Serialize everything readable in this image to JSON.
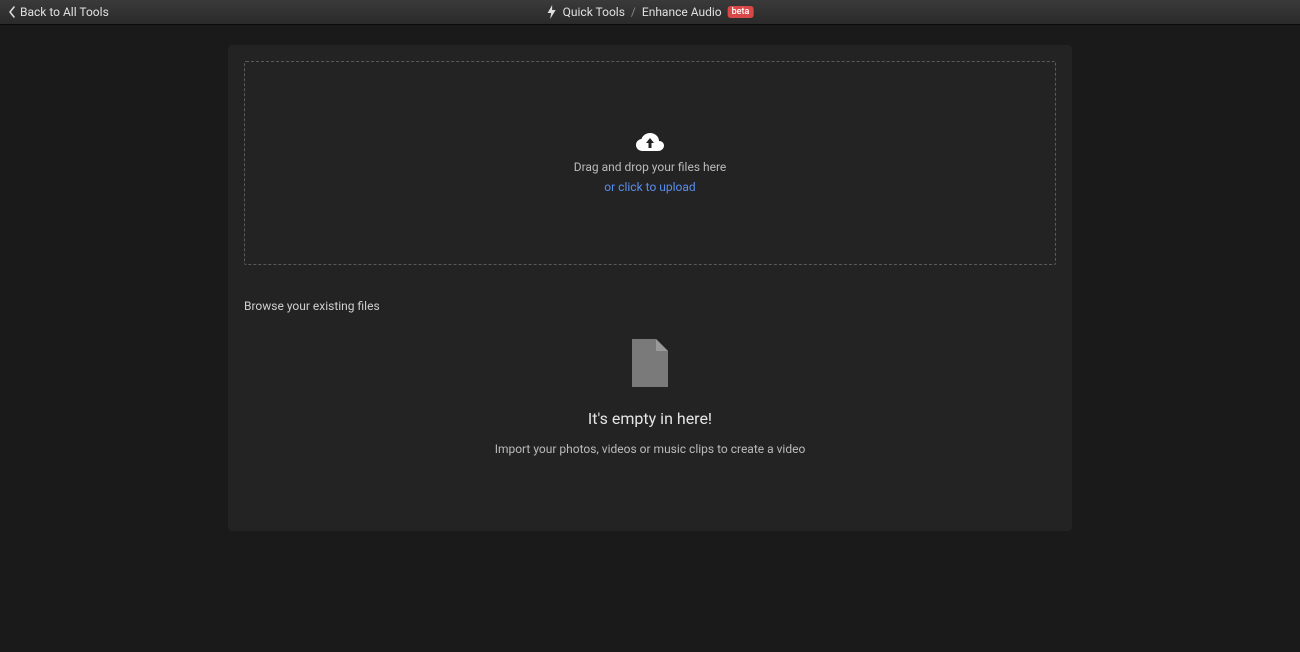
{
  "header": {
    "back_label": "Back to All Tools",
    "breadcrumb_root": "Quick Tools",
    "breadcrumb_current": "Enhance Audio",
    "beta_label": "beta"
  },
  "dropzone": {
    "line1": "Drag and drop your files here",
    "line2": "or click to upload"
  },
  "browse_section": {
    "title": "Browse your existing files"
  },
  "empty_state": {
    "title": "It's empty in here!",
    "subtitle": "Import your photos, videos or music clips to create a video"
  }
}
